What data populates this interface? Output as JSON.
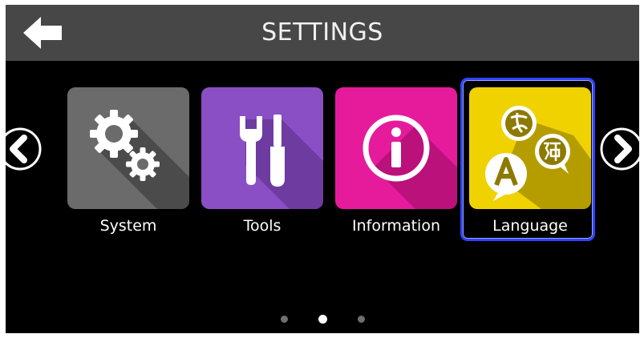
{
  "header": {
    "title": "SETTINGS",
    "back_icon": "back-arrow-icon"
  },
  "carousel": {
    "prev_icon": "chevron-left-icon",
    "next_icon": "chevron-right-icon",
    "page_count": 3,
    "current_page": 2,
    "tiles": [
      {
        "label": "System",
        "icon": "gears-icon",
        "color": "#6b6b6b",
        "selected": false
      },
      {
        "label": "Tools",
        "icon": "tools-icon",
        "color": "#8a4fc4",
        "selected": false
      },
      {
        "label": "Information",
        "icon": "info-icon",
        "color": "#e61b9c",
        "selected": false
      },
      {
        "label": "Language",
        "icon": "language-icon",
        "color": "#f0d200",
        "selected": true
      }
    ]
  },
  "colors": {
    "background": "#000000",
    "header": "#474747",
    "selection": "#2f44ff"
  }
}
